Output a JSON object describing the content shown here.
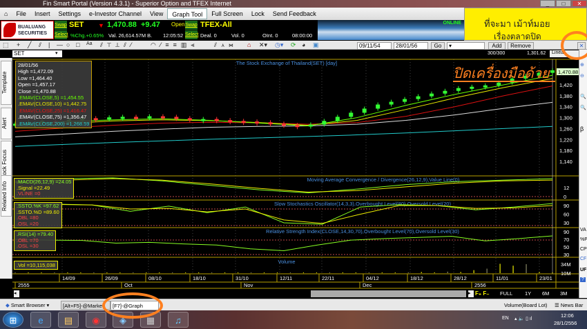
{
  "window": {
    "title": "Fin Smart Portal (Version 4.3.1) - Superior Option and TFEX Internet",
    "min": "_",
    "max": "□",
    "close": "✕"
  },
  "menu": [
    "File",
    "Insert",
    "Settings",
    "e-Investor Channel",
    "View",
    "Graph Tool",
    "Full Screen",
    "Lock",
    "Send Feedback"
  ],
  "logo": {
    "line1": "BUALUANG",
    "line2": "SECURITIES"
  },
  "ticker": {
    "swap": "Swap",
    "select": "Select",
    "symbol": "SET",
    "price": "1,470.88",
    "change": "+9.47",
    "pct": "%Chg.+0.65%",
    "val": "Val. 26,614.57M B.",
    "time": "12:05:52",
    "open": "Open",
    "tfex": {
      "symbol": "TFEX-All",
      "deal": "Deal. 0",
      "vol": "Vol. 0",
      "oint": "OInt. 0",
      "time": "08:00:00"
    }
  },
  "ad": {
    "status": "ONLINE",
    "text1": "ที่จะมา เม้าท์มอย",
    "text2": "เรื่องตลาดปิด"
  },
  "toolbar": {
    "from": "09/11/54",
    "to": "28/01/56",
    "go": "Go",
    "add": "Add",
    "remove": "Remove"
  },
  "symbol_input": "SET",
  "header_bar": {
    "count": "300/300",
    "price": "1,301.62",
    "scale": "Linear"
  },
  "left_tabs": [
    "Template",
    "Alert",
    "Stock Focus",
    "Related Info"
  ],
  "right_tools": [
    "VA",
    "%P",
    "CP",
    "CF",
    "UF",
    "?"
  ],
  "annotation": {
    "text": "ปิดเครื่องมือด้วย"
  },
  "main": {
    "title": "The Stock Exchange of Thailand(SET) [day]",
    "info": [
      "28/01/56",
      "High =1,472.09",
      "Low =1,464.40",
      "Open =1,457.17",
      "Close =1,470.88",
      ".EMAV(CLOSE,5)  =1,454.55",
      ".EMAV(CLOSE,10)  =1,442.75",
      ".EMAV(CLOSE,25)  =1,416.47",
      ".EMAV(CLOSE,75)  =1,356.47",
      ".EMAV(CLOSE,200)  =1,268.59"
    ],
    "axis": [
      "1,420",
      "1,380",
      "1,340",
      "1,300",
      "1,260",
      "1,220",
      "1,180",
      "1,140"
    ],
    "last": "1,470.88"
  },
  "macd": {
    "title": "Moving Average Convergence / Divergence(26,12,9),Value Line(0)",
    "info": [
      ".MACD(26,12,9)  =24.05",
      ".Signal  =22.49",
      ".VLINE  =0"
    ],
    "axis": [
      "12",
      "0"
    ]
  },
  "ssto": {
    "title": "Slow Stochastics Oscillator(14,3,3),Overbought Level(80),Oversold Level(20)",
    "info": [
      ".SSTO.%K  =97.62",
      ".SSTO.%D  =89.60",
      ".OBL  =80",
      ".OSL  =20"
    ],
    "axis": [
      "90",
      "60",
      "30"
    ]
  },
  "rsi": {
    "title": "Relative Strength Index(CLOSE,14,30,70),Overbought Level(70),Oversold Level(30)",
    "info": [
      ".RSI(14)  =79.40",
      ".OBL  =70",
      ".OSL  =30"
    ],
    "axis": [
      "90",
      "70",
      "50",
      "30"
    ]
  },
  "volume": {
    "title": "Volume",
    "info": [
      ".Vol  =10,115,038"
    ],
    "axis": [
      "34M",
      "10M"
    ]
  },
  "dates": [
    "14/09",
    "26/09",
    "08/10",
    "18/10",
    "31/10",
    "12/11",
    "22/11",
    "04/12",
    "18/12",
    "28/12",
    "11/01",
    "23/01"
  ],
  "periods": [
    "2555",
    "Oct",
    "Nov",
    "Dec",
    "2556"
  ],
  "range_buttons": [
    "FULL",
    "1Y",
    "6M",
    "3M"
  ],
  "tabs": {
    "browser": "Smart Browser",
    "t1": "[Alt+F5]-@Market",
    "t2": "[F7]-@Graph",
    "vol": "Volume(Board Lot)",
    "news": "News Bar"
  },
  "taskbar": {
    "lang": "EN",
    "time": "12:06",
    "date": "28/1/2556"
  },
  "colors": {
    "ema5": "#66ff00",
    "ema10": "#e8e800",
    "ema25": "#dd1111",
    "ema75": "#dddddd",
    "ema200": "#22cccc",
    "annot": "#ff8020"
  },
  "chart_data": {
    "type": "line",
    "close": [
      1275,
      1280,
      1285,
      1283,
      1290,
      1295,
      1292,
      1298,
      1300,
      1296,
      1302,
      1300,
      1295,
      1290,
      1292,
      1288,
      1285,
      1283,
      1280,
      1275,
      1270,
      1268,
      1272,
      1285,
      1300,
      1315,
      1330,
      1345,
      1355,
      1365,
      1375,
      1385,
      1395,
      1405,
      1410,
      1415,
      1425,
      1440,
      1450,
      1461,
      1470
    ],
    "ema5": [
      1272,
      1285,
      1292,
      1296,
      1290,
      1280,
      1270,
      1300,
      1345,
      1385,
      1420,
      1455
    ],
    "ema10": [
      1265,
      1278,
      1288,
      1292,
      1289,
      1282,
      1272,
      1290,
      1330,
      1372,
      1410,
      1443
    ],
    "ema25": [
      1250,
      1262,
      1272,
      1280,
      1283,
      1281,
      1276,
      1282,
      1305,
      1340,
      1380,
      1416
    ],
    "ema75": [
      1230,
      1240,
      1250,
      1258,
      1265,
      1268,
      1270,
      1276,
      1290,
      1310,
      1334,
      1356
    ],
    "ema200": [
      1195,
      1202,
      1209,
      1215,
      1221,
      1226,
      1231,
      1237,
      1244,
      1252,
      1260,
      1268
    ],
    "macd": [
      20,
      24,
      25,
      21,
      15,
      9,
      5,
      10,
      16,
      20,
      22,
      24
    ],
    "signal": [
      19,
      22,
      24,
      22,
      17,
      11,
      6,
      8,
      13,
      18,
      21,
      22
    ],
    "ssto_k": [
      95,
      95,
      92,
      70,
      88,
      65,
      85,
      30,
      25,
      85,
      93,
      90,
      75,
      85,
      97
    ],
    "ssto_d": [
      93,
      94,
      92,
      78,
      80,
      68,
      78,
      40,
      28,
      60,
      90,
      90,
      80,
      82,
      90
    ],
    "rsi": [
      70,
      68,
      67,
      60,
      62,
      58,
      55,
      45,
      40,
      55,
      68,
      72,
      75,
      78,
      66,
      72,
      79
    ],
    "volume": [
      3,
      3,
      2,
      3,
      2,
      3,
      2,
      3,
      3,
      2,
      3,
      2,
      3,
      2,
      2,
      3,
      2,
      3,
      2,
      3,
      3,
      4,
      4,
      5,
      6,
      7,
      8,
      9,
      10,
      11,
      12,
      13,
      12,
      14,
      13,
      18,
      22,
      35,
      30,
      34,
      13,
      10
    ],
    "ylim": [
      1140,
      1480
    ]
  }
}
